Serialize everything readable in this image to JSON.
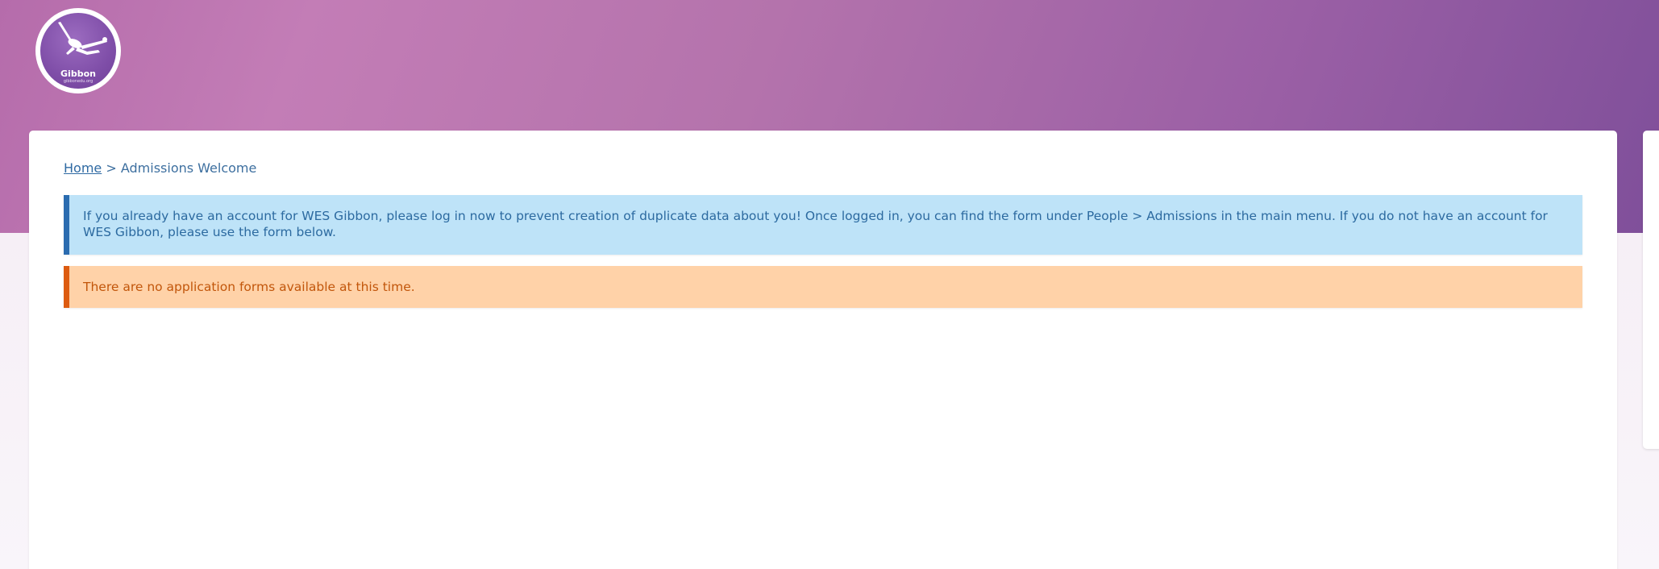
{
  "logo": {
    "icon": "gibbon-swinging-icon",
    "name": "Gibbon",
    "tagline": "gibbonedu.org"
  },
  "breadcrumb": {
    "home_label": "Home",
    "separator": ">",
    "current": "Admissions Welcome"
  },
  "alerts": {
    "info": "If you already have an account for WES Gibbon, please log in now to prevent creation of duplicate data about you! Once logged in, you can find the form under People > Admissions in the main menu. If you do not have an account for WES Gibbon, please use the form below.",
    "warning": "There are no application forms available at this time."
  },
  "colors": {
    "header_gradient_start": "#b56cab",
    "header_gradient_end": "#7f4f9a",
    "info_bg": "#bee3f8",
    "info_border": "#2b6cb0",
    "warning_bg": "#ffd2a8",
    "warning_border": "#dd5b10"
  }
}
